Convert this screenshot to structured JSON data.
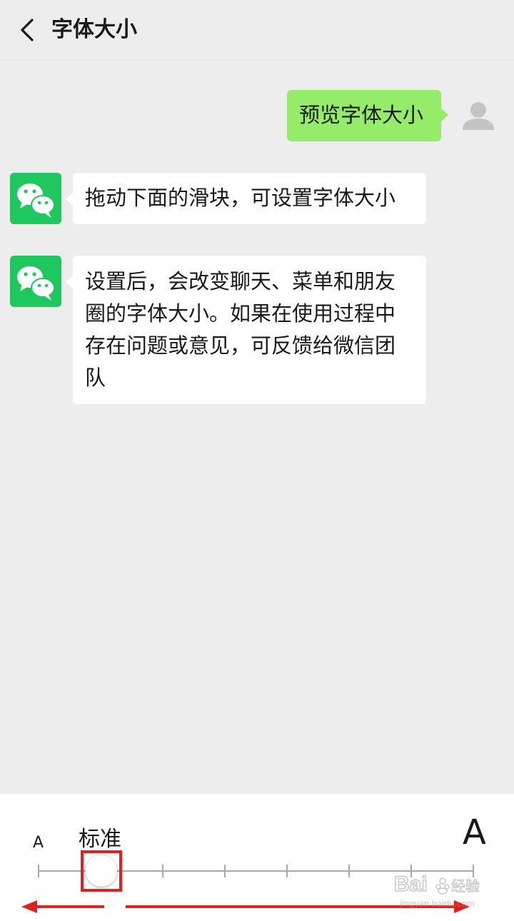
{
  "header": {
    "back_icon": "chevron-left-icon",
    "title": "字体大小"
  },
  "chat": {
    "preview_message": "预览字体大小",
    "message_1": "拖动下面的滑块，可设置字体大小",
    "message_2": "设置后，会改变聊天、菜单和朋友圈的字体大小。如果在使用过程中存在问题或意见，可反馈给微信团队"
  },
  "font_slider": {
    "small_label": "A",
    "large_label": "A",
    "current_level_label": "标准",
    "steps": 8,
    "current_step": 1,
    "accent_color": "#e02020"
  },
  "colors": {
    "wechat_green": "#1fc75f",
    "sent_bubble": "#95ec69",
    "background": "#ededed"
  },
  "watermark": {
    "brand": "Bai",
    "brand_suffix": "经验",
    "url": "jingyan.baidu.com"
  }
}
